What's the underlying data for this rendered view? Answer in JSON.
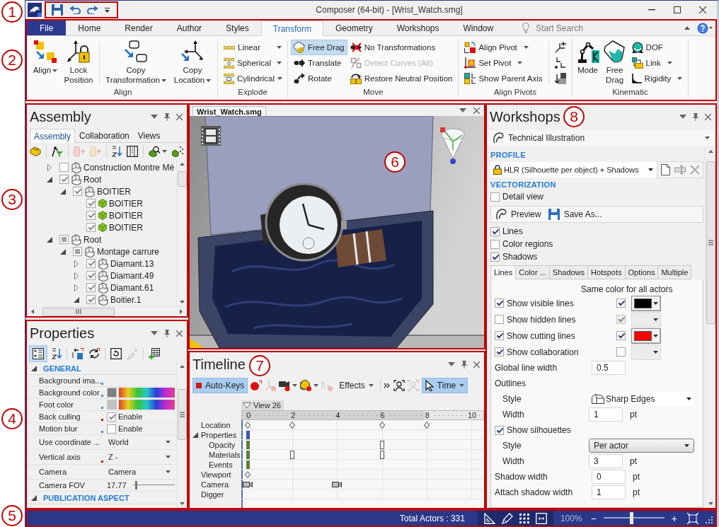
{
  "title_bar": {
    "title": "Composer (64-bit) - [Wrist_Watch.smg]",
    "quick_access": {
      "callout": "1"
    }
  },
  "ribbon": {
    "callout": "2",
    "tabs": [
      {
        "label": "File",
        "kind": "backstage",
        "selected": false
      },
      {
        "label": "Home",
        "kind": "tab",
        "selected": false
      },
      {
        "label": "Render",
        "kind": "tab",
        "selected": false
      },
      {
        "label": "Author",
        "kind": "tab",
        "selected": false
      },
      {
        "label": "Styles",
        "kind": "tab",
        "selected": false
      },
      {
        "label": "Transform",
        "kind": "tab",
        "selected": true
      },
      {
        "label": "Geometry",
        "kind": "tab",
        "selected": false
      },
      {
        "label": "Workshops",
        "kind": "tab",
        "selected": false
      },
      {
        "label": "Window",
        "kind": "tab",
        "selected": false
      }
    ],
    "search": {
      "placeholder": "Start Search"
    },
    "groups": [
      {
        "label": "Align",
        "kind": "large",
        "items": [
          {
            "label": "Align",
            "dropdown": true
          },
          {
            "label": "Lock Position",
            "dropdown": false
          },
          {
            "label": "Copy Transformation",
            "dropdown": true
          },
          {
            "label": "Copy Location",
            "dropdown": true
          }
        ]
      },
      {
        "label": "Explode",
        "kind": "list",
        "items": [
          {
            "label": "Linear",
            "dropdown": true
          },
          {
            "label": "Spherical",
            "dropdown": true
          },
          {
            "label": "Cylindrical",
            "dropdown": true
          }
        ]
      },
      {
        "label": "Move",
        "kind": "columns",
        "items": [
          {
            "label": "Free Drag",
            "selected": true,
            "disabled": false
          },
          {
            "label": "Translate",
            "selected": false,
            "disabled": false
          },
          {
            "label": "Rotate",
            "selected": false,
            "disabled": false
          },
          {
            "label": "No Transformations",
            "selected": false,
            "disabled": false
          },
          {
            "label": "Detect Curves (Alt)",
            "selected": false,
            "disabled": true
          },
          {
            "label": "Restore Neutral Position",
            "selected": false,
            "disabled": false
          }
        ]
      },
      {
        "label": "Align Pivots",
        "kind": "pivots",
        "items": [
          {
            "label": "Align Pivot",
            "dropdown": true
          },
          {
            "label": "Set Pivot",
            "dropdown": true
          },
          {
            "label": "Show Parent Axis",
            "dropdown": false
          }
        ]
      },
      {
        "label": "Kinematic",
        "kind": "kinematic",
        "items": [
          {
            "label": "Mode",
            "dropdown": false
          },
          {
            "label": "Free Drag",
            "dropdown": false
          },
          {
            "label": "DOF",
            "dropdown": false
          },
          {
            "label": "Link",
            "dropdown": true
          },
          {
            "label": "Rigidity",
            "dropdown": true
          }
        ]
      }
    ]
  },
  "assembly": {
    "callout": "3",
    "title": "Assembly",
    "tabs": [
      {
        "label": "Assembly",
        "selected": true
      },
      {
        "label": "Collaboration",
        "selected": false
      },
      {
        "label": "Views",
        "selected": false
      }
    ],
    "tree": [
      {
        "label": "Construction Montre Mé",
        "kind": "assembly",
        "checked": false,
        "partial": false,
        "expanded": false
      },
      {
        "label": "Root",
        "kind": "assembly",
        "checked": true,
        "partial": false,
        "expanded": true,
        "children": [
          {
            "label": "BOITIER",
            "kind": "assembly",
            "checked": true,
            "partial": false,
            "expanded": true,
            "children": [
              {
                "label": "BOITIER",
                "kind": "part",
                "checked": true,
                "partial": false
              },
              {
                "label": "BOITIER",
                "kind": "part",
                "checked": true,
                "partial": false
              },
              {
                "label": "BOITIER",
                "kind": "part",
                "checked": true,
                "partial": false
              }
            ]
          }
        ]
      },
      {
        "label": "Root",
        "kind": "assembly",
        "checked": false,
        "partial": true,
        "expanded": true,
        "children": [
          {
            "label": "Montage carrure",
            "kind": "assembly",
            "checked": false,
            "partial": true,
            "expanded": true,
            "children": [
              {
                "label": "Diamant.13",
                "kind": "assembly",
                "checked": true,
                "partial": false,
                "expanded": false
              },
              {
                "label": "Diamant.49",
                "kind": "assembly",
                "checked": true,
                "partial": false,
                "expanded": false
              },
              {
                "label": "Diamant.61",
                "kind": "assembly",
                "checked": true,
                "partial": false,
                "expanded": false
              },
              {
                "label": "Boitier.1",
                "kind": "assembly",
                "checked": true,
                "partial": false,
                "expanded": true
              }
            ]
          }
        ]
      }
    ]
  },
  "properties": {
    "callout": "4",
    "title": "Properties",
    "toolbar": {
      "categorized": true
    },
    "sections": [
      {
        "title": "GENERAL",
        "expanded": true,
        "rows": [
          {
            "label": "Background ima...",
            "kind": "text",
            "marker": {
              "color": "#4a8fd8"
            }
          },
          {
            "label": "Background color",
            "kind": "color",
            "marker": {
              "color": "#4a8fd8"
            },
            "swatch": {
              "color": "#808080"
            }
          },
          {
            "label": "Foot color",
            "kind": "color",
            "marker": {
              "color": "#4a8fd8"
            },
            "swatch": {
              "color": "#c0c0c0"
            }
          },
          {
            "label": "Back culling",
            "kind": "checkbox",
            "marker": {
              "color": "#e00000"
            },
            "checked": true,
            "value": "Enable"
          },
          {
            "label": "Motion blur",
            "kind": "checkbox",
            "marker": {
              "color": "#4a8fd8"
            },
            "checked": false,
            "value": "Enable"
          },
          {
            "label": "Use coordinate ...",
            "kind": "dropdown",
            "value": "World"
          },
          {
            "label": "Vertical axis",
            "kind": "dropdown",
            "marker": {
              "color": "#e00000"
            },
            "value": "Z -"
          },
          {
            "label": "Camera",
            "kind": "dropdown",
            "value": "Camera"
          },
          {
            "label": "Camera FOV",
            "kind": "slider",
            "value": "17.77",
            "level": 0.08
          }
        ]
      },
      {
        "title": "PUBLICATION ASPECT",
        "expanded": true
      }
    ]
  },
  "viewport": {
    "callout": "6",
    "tabs": [
      {
        "label": "Wrist_Watch.smg",
        "selected": true
      }
    ]
  },
  "timeline": {
    "callout": "7",
    "title": "Timeline",
    "auto_keys": {
      "label": "Auto-Keys",
      "selected": true
    },
    "effects": {
      "label": "Effects"
    },
    "mode": {
      "label": "Time",
      "selected": true
    },
    "marker": {
      "label": "View 26"
    },
    "ruler": [
      {
        "label": "0",
        "shaded": true,
        "playhead": true
      },
      {
        "label": "2",
        "shaded": true,
        "playhead": false
      },
      {
        "label": "4",
        "shaded": true,
        "playhead": false
      },
      {
        "label": "6",
        "shaded": true,
        "playhead": false
      },
      {
        "label": "8",
        "shaded": false,
        "playhead": false
      },
      {
        "label": "10",
        "shaded": false,
        "playhead": false
      }
    ],
    "tracks": [
      {
        "label": "Location",
        "keys": [
          {
            "kind": "diamond"
          },
          {
            "kind": "diamond"
          },
          {
            "kind": "none"
          },
          {
            "kind": "diamond"
          },
          {
            "kind": "diamond"
          },
          {
            "kind": "none"
          }
        ]
      },
      {
        "label": "Properties",
        "expanded": true,
        "keys": [
          {
            "kind": "bar",
            "color": "#3556a8"
          },
          {
            "kind": "none"
          },
          {
            "kind": "none"
          },
          {
            "kind": "none"
          },
          {
            "kind": "none"
          },
          {
            "kind": "none"
          }
        ],
        "children": [
          {
            "label": "Opacity",
            "keys": [
              {
                "kind": "bar",
                "color": "#5f7f3a"
              },
              {
                "kind": "none"
              },
              {
                "kind": "none"
              },
              {
                "kind": "box"
              },
              {
                "kind": "none"
              },
              {
                "kind": "none"
              }
            ]
          },
          {
            "label": "Materials",
            "keys": [
              {
                "kind": "bar",
                "color": "#5f7f3a"
              },
              {
                "kind": "box"
              },
              {
                "kind": "none"
              },
              {
                "kind": "box"
              },
              {
                "kind": "none"
              },
              {
                "kind": "none"
              }
            ]
          },
          {
            "label": "Events",
            "keys": [
              {
                "kind": "bar",
                "color": "#5f7f3a"
              },
              {
                "kind": "none"
              },
              {
                "kind": "none"
              },
              {
                "kind": "none"
              },
              {
                "kind": "none"
              },
              {
                "kind": "none"
              }
            ]
          }
        ]
      },
      {
        "label": "Viewport",
        "keys": [
          {
            "kind": "diamond"
          },
          {
            "kind": "none"
          },
          {
            "kind": "none"
          },
          {
            "kind": "none"
          },
          {
            "kind": "none"
          },
          {
            "kind": "none"
          }
        ]
      },
      {
        "label": "Camera",
        "keys": [
          {
            "kind": "camera"
          },
          {
            "kind": "none"
          },
          {
            "kind": "camera"
          },
          {
            "kind": "none"
          },
          {
            "kind": "none"
          },
          {
            "kind": "none"
          }
        ]
      },
      {
        "label": "Digger"
      }
    ]
  },
  "workshops": {
    "callout": "8",
    "title": "Workshops",
    "workshop": {
      "label": "Technical Illustration"
    },
    "profile": {
      "heading": "PROFILE",
      "value": "HLR (Silhouette per object) + Shadows"
    },
    "vectorization": {
      "heading": "VECTORIZATION",
      "detail_view": {
        "label": "Detail view",
        "checked": false
      },
      "actions": [
        {
          "label": "Preview"
        },
        {
          "label": "Save As..."
        }
      ],
      "layers": [
        {
          "label": "Lines",
          "checked": true
        },
        {
          "label": "Color regions",
          "checked": false
        },
        {
          "label": "Shadows",
          "checked": true
        }
      ]
    },
    "tabs": [
      {
        "label": "Lines",
        "selected": true
      },
      {
        "label": "Color ...",
        "selected": false
      },
      {
        "label": "Shadows",
        "selected": false
      },
      {
        "label": "Hotspots",
        "selected": false
      },
      {
        "label": "Options",
        "selected": false
      },
      {
        "label": "Multiple",
        "selected": false
      }
    ],
    "lines": {
      "same_color_heading": "Same color for all actors",
      "rows": [
        {
          "label": "Show visible lines",
          "checked": true,
          "same_color": true,
          "disabled": false,
          "color": "#000000"
        },
        {
          "label": "Show hidden lines",
          "checked": false,
          "same_color": true,
          "disabled": true
        },
        {
          "label": "Show cutting lines",
          "checked": true,
          "same_color": true,
          "disabled": false,
          "color": "#ff0000"
        },
        {
          "label": "Show collaboration",
          "checked": true,
          "same_color": false,
          "disabled": false
        }
      ],
      "fields": [
        {
          "kind": "number",
          "label": "Global line width",
          "value": "0.5"
        },
        {
          "kind": "group",
          "label": "Outlines",
          "children": [
            {
              "kind": "style_picker",
              "label": "Style",
              "value": "Sharp Edges"
            },
            {
              "kind": "number",
              "label": "Width",
              "value": "1",
              "unit": "pt"
            }
          ]
        },
        {
          "kind": "check_group",
          "label": "Show silhouettes",
          "checked": true,
          "children": [
            {
              "kind": "combo",
              "label": "Style",
              "value": "Per actor"
            },
            {
              "kind": "number",
              "label": "Width",
              "value": "3",
              "unit": "pt"
            }
          ]
        },
        {
          "kind": "number",
          "label": "Shadow width",
          "value": "0",
          "unit": "pt"
        },
        {
          "kind": "number",
          "label": "Attach shadow width",
          "value": "1",
          "unit": "pt"
        }
      ]
    }
  },
  "status_bar": {
    "callout": "5",
    "total_actors": "Total Actors : 331",
    "zoom": {
      "value": "100%",
      "minus": "−",
      "plus": "+",
      "level": 0.45
    }
  }
}
